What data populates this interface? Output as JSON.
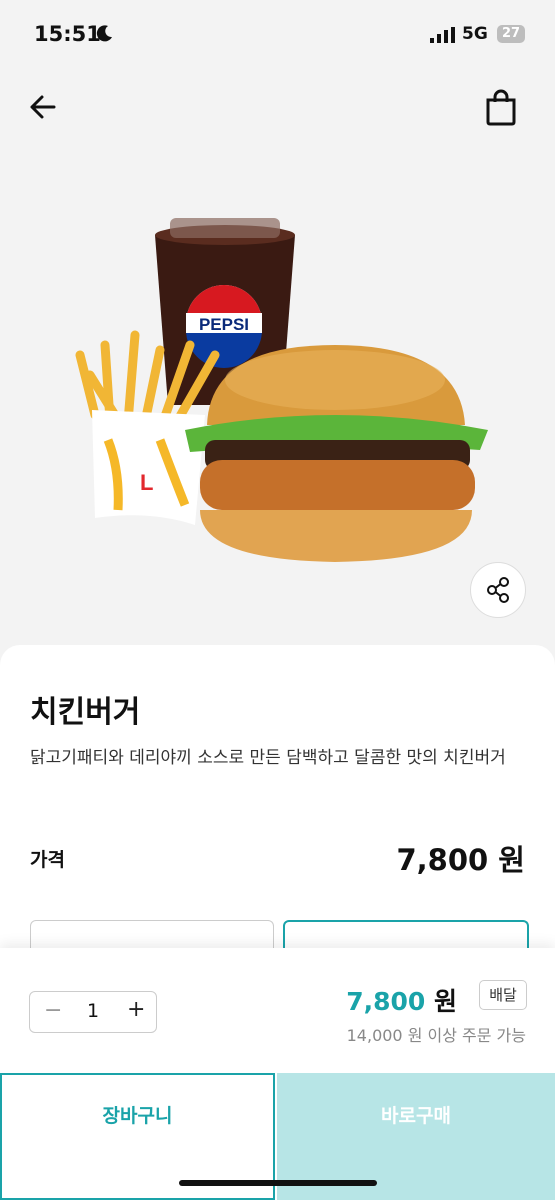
{
  "status": {
    "time": "15:51",
    "network": "5G",
    "battery": "27"
  },
  "nav": {
    "back_icon": "arrow-left-icon",
    "cart_icon": "shopping-bag-icon"
  },
  "product": {
    "name": "치킨버거",
    "description": "닭고기패티와 데리야끼 소스로 만든 담백하고 달콤한 맛의 치킨버거",
    "price_label": "가격",
    "price": "7,800 원",
    "image_brand_text": "PEPSI"
  },
  "order": {
    "quantity": "1",
    "minus": "−",
    "plus": "+",
    "total_amount": "7,800",
    "total_unit": "원",
    "delivery_badge": "배달",
    "min_order": "14,000 원 이상 주문 가능",
    "cart_button": "장바구니",
    "buy_button": "바로구매"
  },
  "colors": {
    "accent": "#1aa3a9",
    "buy_bg": "#b7e5e6"
  }
}
